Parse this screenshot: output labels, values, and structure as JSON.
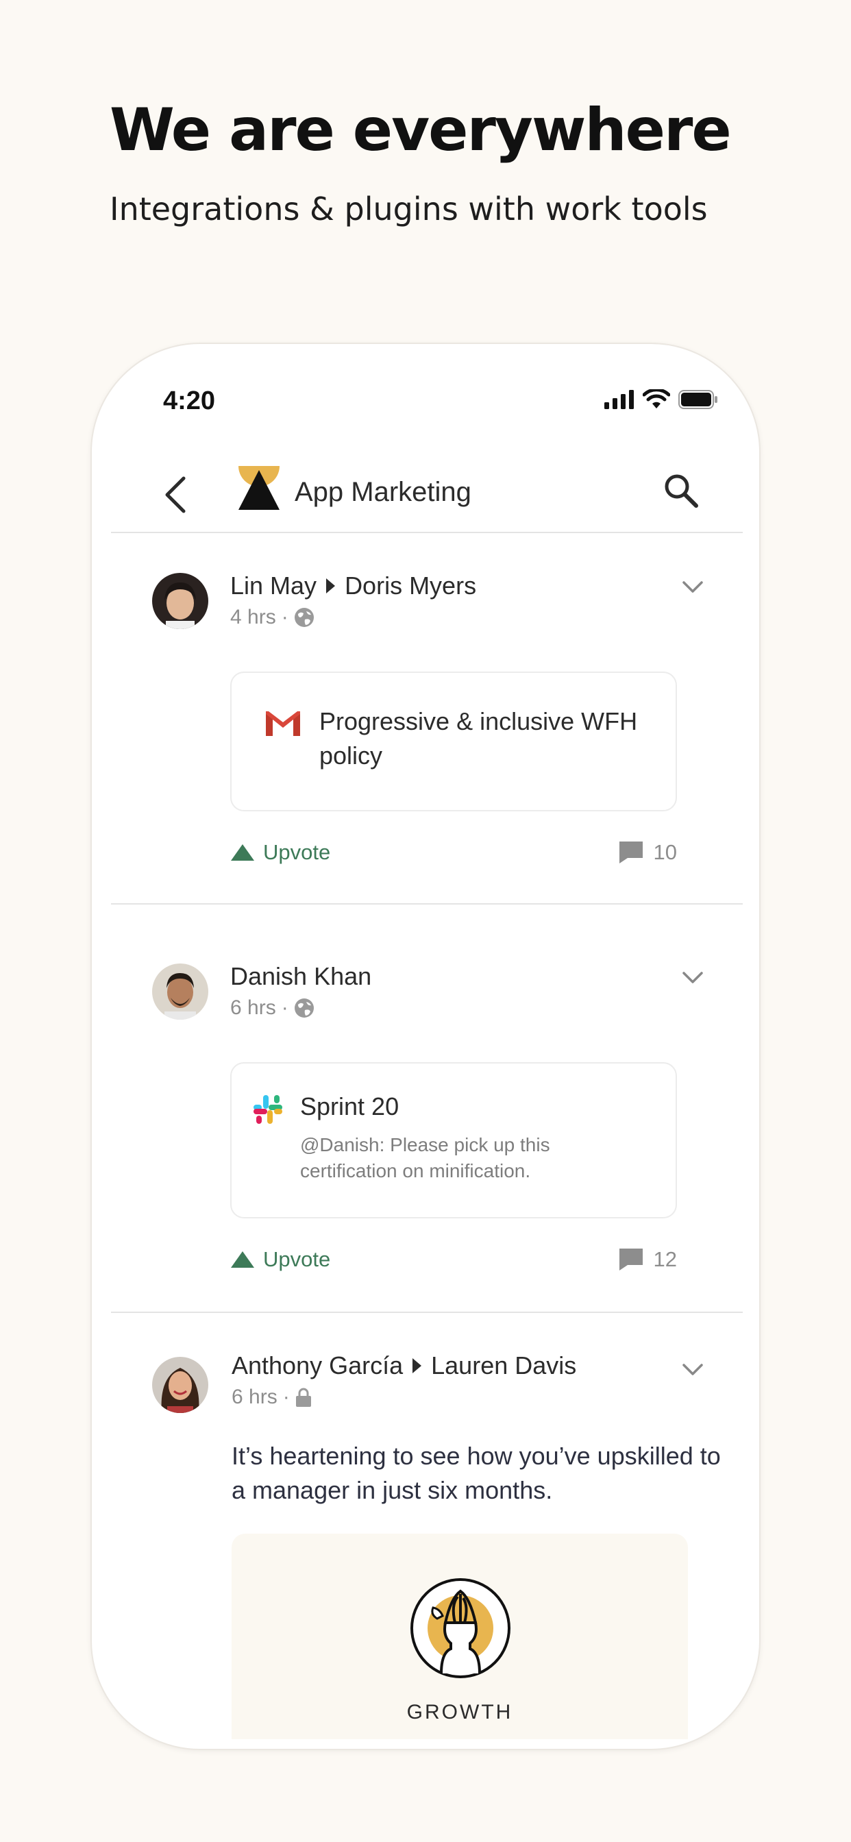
{
  "headline": "We are everywhere",
  "subheadline": "Integrations & plugins with work tools",
  "status_bar": {
    "time": "4:20"
  },
  "nav": {
    "title": "App Marketing"
  },
  "posts": [
    {
      "author": "Lin May",
      "recipient": "Doris Myers",
      "time": "4 hrs",
      "visibility": "globe-icon",
      "card": {
        "source": "gmail-icon",
        "title": "Progressive & inclusive WFH policy"
      },
      "upvote_label": "Upvote",
      "comment_count": "10"
    },
    {
      "author": "Danish Khan",
      "time": "6 hrs",
      "visibility": "globe-icon",
      "card": {
        "source": "slack-icon",
        "title": "Sprint 20",
        "description": "@Danish: Please pick up this certification on minification."
      },
      "upvote_label": "Upvote",
      "comment_count": "12"
    },
    {
      "author": "Anthony García",
      "recipient": "Lauren Davis",
      "time": "6 hrs",
      "visibility": "lock-icon",
      "text": "It’s heartening to see how you’ve upskilled to a manager in just six months.",
      "badge": {
        "label": "GROWTH"
      }
    }
  ],
  "colors": {
    "background": "#fcf9f4",
    "accent_green": "#3d7a58",
    "badge_gold": "#e8b54f"
  }
}
